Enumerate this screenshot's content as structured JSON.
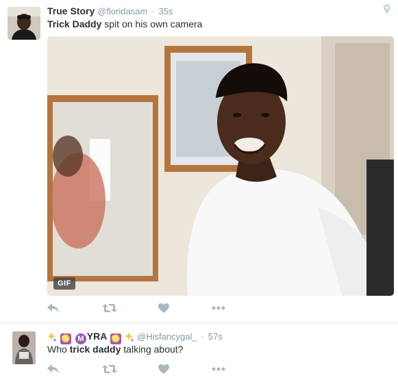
{
  "tweets": [
    {
      "name": "True Story",
      "handle": "@floridasam",
      "separator": "·",
      "time": "35s",
      "text_bold": "Trick Daddy",
      "text_rest": " spit on his own camera",
      "has_location": true,
      "media": {
        "badge": "GIF"
      },
      "actions": [
        "reply-icon",
        "retweet-icon",
        "like-icon",
        "more-icon"
      ]
    },
    {
      "name_badge_text": "YRA",
      "name_m": "M",
      "name_sq": "♋",
      "handle": "@Hisfancygal_",
      "separator": "·",
      "time": "57s",
      "text_pre": "Who ",
      "text_bold": "trick daddy",
      "text_post": " talking about?",
      "actions": [
        "reply-icon",
        "retweet-icon",
        "like-icon",
        "more-icon"
      ]
    }
  ],
  "colors": {
    "text": "#292f33",
    "muted": "#8899a6",
    "action_icon": "#aab8c2",
    "divider": "#e1e8ed"
  }
}
